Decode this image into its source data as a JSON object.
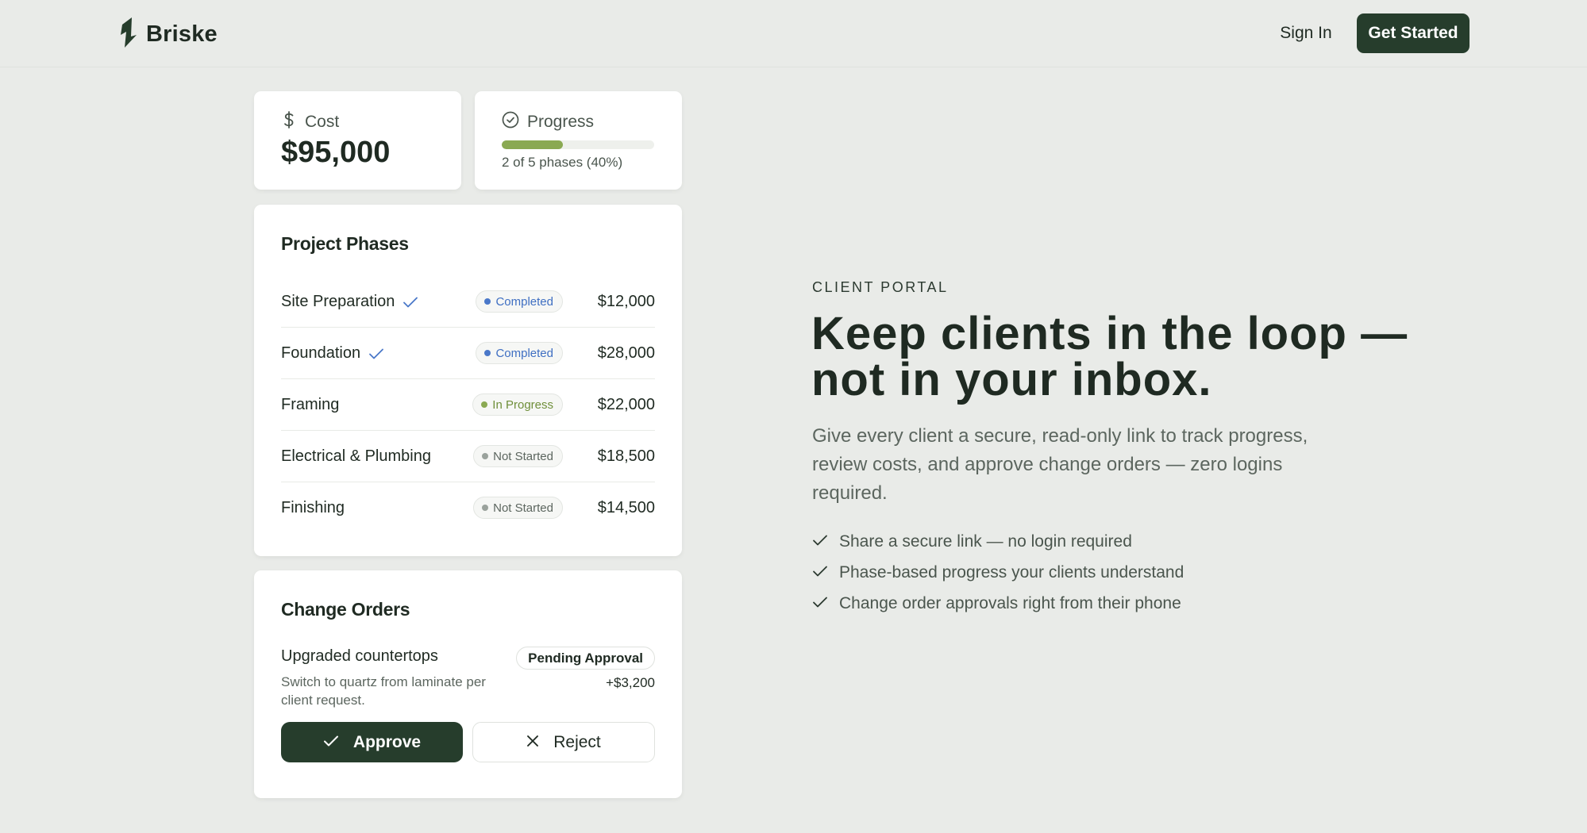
{
  "header": {
    "brand": "Briske",
    "sign_in": "Sign In",
    "get_started": "Get Started"
  },
  "cost": {
    "label": "Cost",
    "value": "$95,000"
  },
  "progress": {
    "label": "Progress",
    "fraction": 0.4,
    "text": "2 of 5 phases (40%)"
  },
  "phases": {
    "title": "Project Phases",
    "items": [
      {
        "name": "Site Preparation",
        "done": true,
        "status": "Completed",
        "amount": "$12,000"
      },
      {
        "name": "Foundation",
        "done": true,
        "status": "Completed",
        "amount": "$28,000"
      },
      {
        "name": "Framing",
        "done": false,
        "status": "In Progress",
        "amount": "$22,000"
      },
      {
        "name": "Electrical & Plumbing",
        "done": false,
        "status": "Not Started",
        "amount": "$18,500"
      },
      {
        "name": "Finishing",
        "done": false,
        "status": "Not Started",
        "amount": "$14,500"
      }
    ],
    "status_colors": {
      "Completed": "#3f6fc2",
      "In Progress": "#6f8f3a",
      "Not Started": "#5c665f"
    },
    "dot_colors": {
      "Completed": "#4a78c9",
      "In Progress": "#8aa952",
      "Not Started": "#9aa29c"
    }
  },
  "orders": {
    "title": "Change Orders",
    "item": {
      "name": "Upgraded countertops",
      "description": "Switch to quartz from laminate per client request.",
      "status": "Pending Approval",
      "amount": "+$3,200"
    },
    "approve": "Approve",
    "reject": "Reject"
  },
  "hero": {
    "eyebrow": "CLIENT PORTAL",
    "headline": "Keep clients in the loop — not in your inbox.",
    "lead": "Give every client a secure, read-only link to track progress, review costs, and approve change orders — zero logins required.",
    "features": [
      "Share a secure link — no login required",
      "Phase-based progress your clients understand",
      "Change order approvals right from their phone"
    ]
  },
  "colors": {
    "accent": "#263d2c",
    "progress": "#8aa952",
    "background": "#e9ebe8"
  }
}
